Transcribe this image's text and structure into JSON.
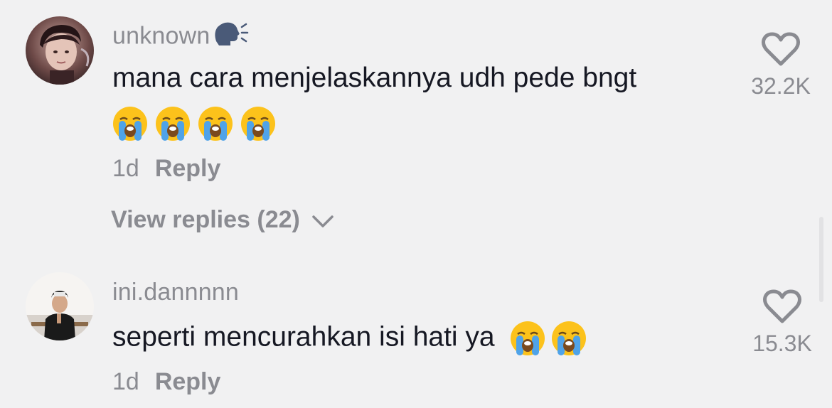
{
  "comments": [
    {
      "username": "unknown",
      "username_icon": "speaking-head-icon",
      "text": "mana cara menjelaskannya udh pede bngt",
      "emoji_count": 4,
      "emoji_name": "loudly-crying-face-icon",
      "time": "1d",
      "reply_label": "Reply",
      "likes": "32.2K",
      "view_replies_label": "View replies (22)"
    },
    {
      "username": "ini.dannnnn",
      "text": "seperti mencurahkan isi hati ya",
      "emoji_count": 2,
      "emoji_name": "loudly-crying-face-icon",
      "time": "1d",
      "reply_label": "Reply",
      "likes": "15.3K"
    }
  ],
  "colors": {
    "background": "#f1f1f2",
    "primary_text": "#161823",
    "secondary_text": "#8a8b91"
  }
}
